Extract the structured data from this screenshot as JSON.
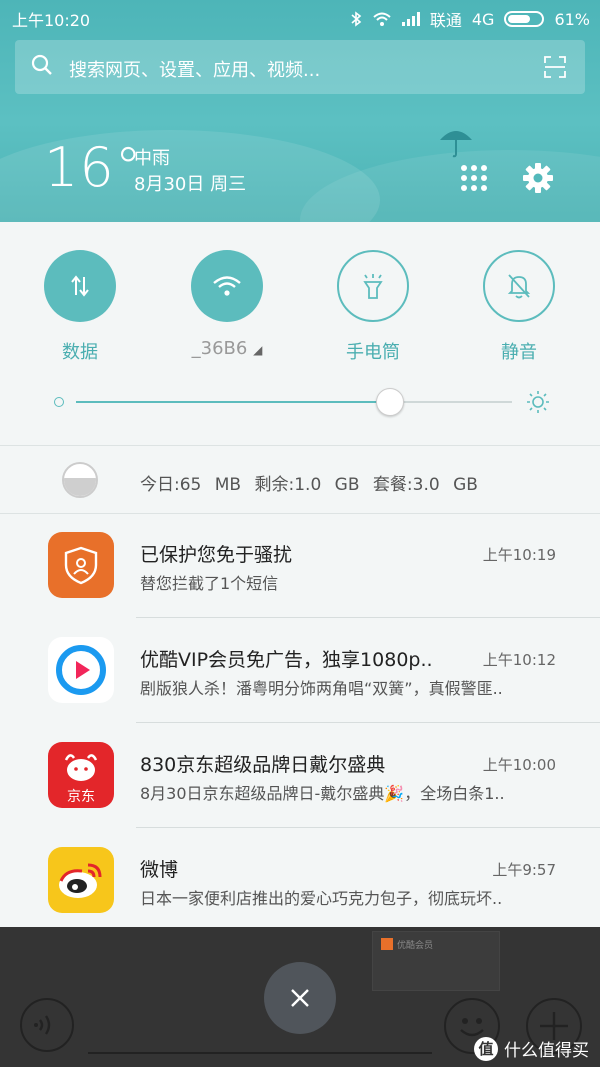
{
  "status_bar": {
    "time": "上午10:20",
    "carrier": "联通",
    "network": "4G",
    "battery": "61%",
    "battery_level": 0.61
  },
  "search": {
    "placeholder": "搜索网页、设置、应用、视频..."
  },
  "weather": {
    "temperature": "16°",
    "condition": "中雨",
    "date": "8月30日 周三"
  },
  "quick_settings": {
    "toggles": [
      {
        "label": "数据",
        "icon": "data-arrows-icon",
        "active": true
      },
      {
        "label": "_36B6",
        "icon": "wifi-icon",
        "active": true
      },
      {
        "label": "手电筒",
        "icon": "flashlight-icon",
        "active": false
      },
      {
        "label": "静音",
        "icon": "bell-mute-icon",
        "active": false
      }
    ],
    "brightness_level": 0.72
  },
  "data_usage": {
    "text": "今日:65 MB  剩余:1.0 GB  套餐:3.0 GB"
  },
  "notifications": [
    {
      "app": "security",
      "title": "已保护您免于骚扰",
      "body": "替您拦截了1个短信",
      "time": "上午10:19"
    },
    {
      "app": "youku",
      "title": "优酷VIP会员免广告，独享1080p..",
      "body": "剧版狼人杀！潘粤明分饰两角唱“双簧”，真假警匪..",
      "time": "上午10:12"
    },
    {
      "app": "jd",
      "title": "830京东超级品牌日戴尔盛典",
      "body": "8月30日京东超级品牌日-戴尔盛典🎉，全场白条1..",
      "time": "上午10:00"
    },
    {
      "app": "weibo",
      "title": "微博",
      "body": "日本一家便利店推出的爱心巧克力包子，彻底玩坏..",
      "time": "上午9:57"
    }
  ],
  "jd_icon_text": "京东",
  "ghost_text": "优酷会员",
  "watermark": "什么值得买",
  "watermark_glyph": "值",
  "colors": {
    "accent": "#5cbcbd",
    "header": "#4db5b8"
  }
}
